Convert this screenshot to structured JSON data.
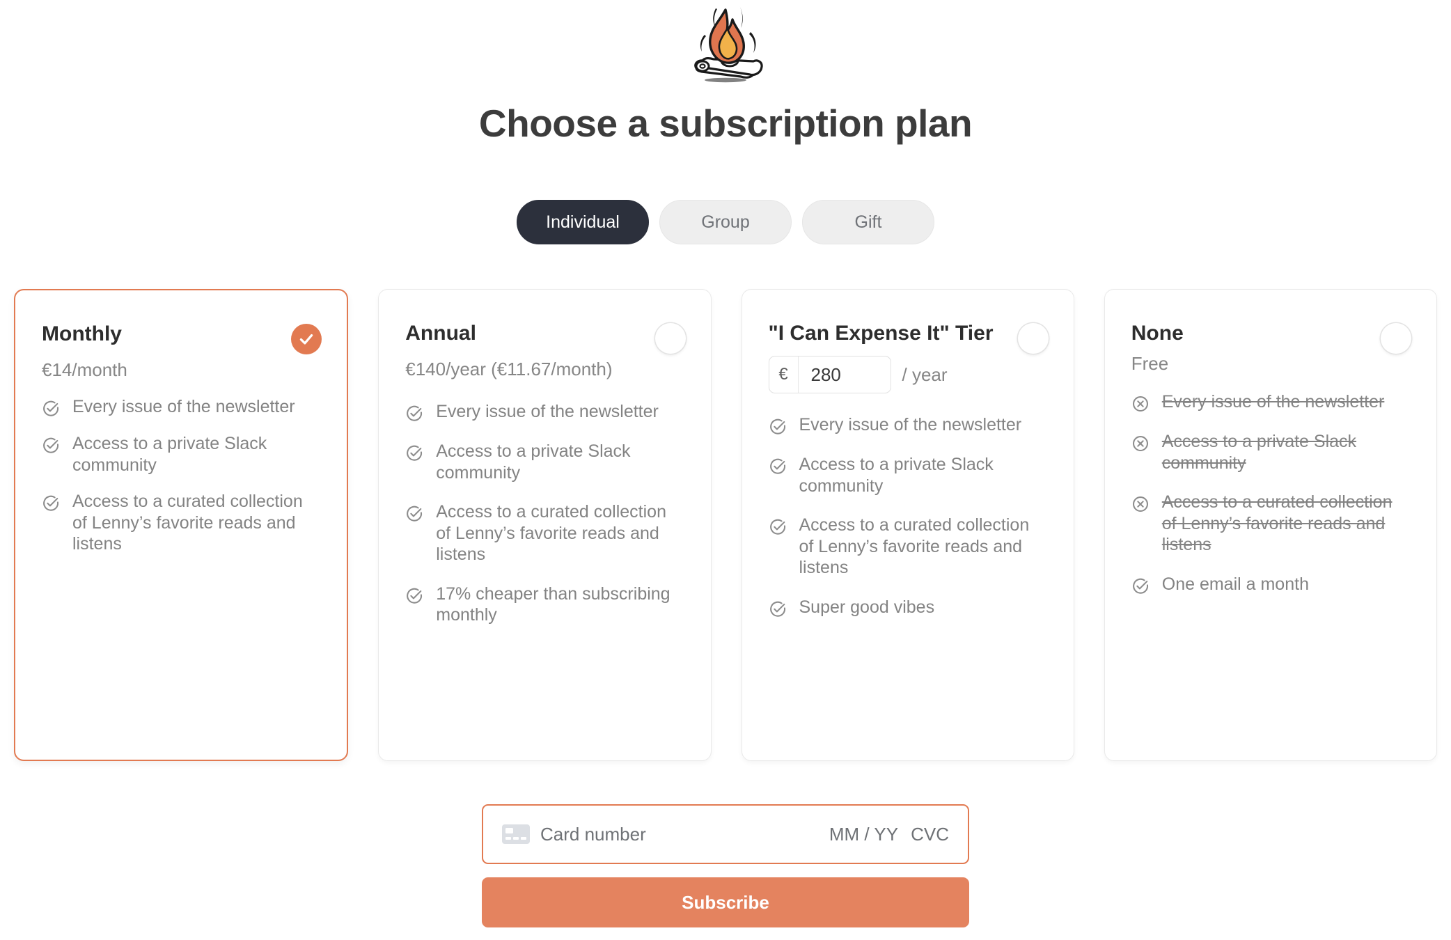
{
  "brand": {
    "logo_icon": "campfire-icon",
    "accent_color": "#e27a51",
    "button_color": "#e4835f",
    "dark_color": "#2c303c"
  },
  "header": {
    "title": "Choose a subscription plan"
  },
  "tabs": [
    {
      "label": "Individual",
      "active": true
    },
    {
      "label": "Group",
      "active": false
    },
    {
      "label": "Gift",
      "active": false
    }
  ],
  "plans": [
    {
      "name": "Monthly",
      "price": "€14/month",
      "selected": true,
      "selected_icon": "check-circle-filled-icon",
      "features": [
        {
          "text": "Every issue of the newsletter",
          "available": true,
          "icon": "check-circle-icon"
        },
        {
          "text": "Access to a private Slack community",
          "available": true,
          "icon": "check-circle-icon"
        },
        {
          "text": "Access to a curated collection of Lenny’s favorite reads and listens",
          "available": true,
          "icon": "check-circle-icon"
        }
      ]
    },
    {
      "name": "Annual",
      "price": "€140/year (€11.67/month)",
      "selected": false,
      "features": [
        {
          "text": "Every issue of the newsletter",
          "available": true,
          "icon": "check-circle-icon"
        },
        {
          "text": "Access to a private Slack community",
          "available": true,
          "icon": "check-circle-icon"
        },
        {
          "text": "Access to a curated collection of Lenny’s favorite reads and listens",
          "available": true,
          "icon": "check-circle-icon"
        },
        {
          "text": "17% cheaper than subscribing monthly",
          "available": true,
          "icon": "check-circle-icon"
        }
      ]
    },
    {
      "name": "\"I Can Expense It\" Tier",
      "selected": false,
      "custom_price": {
        "currency_symbol": "€",
        "amount": "280",
        "suffix": "/ year"
      },
      "features": [
        {
          "text": "Every issue of the newsletter",
          "available": true,
          "icon": "check-circle-icon"
        },
        {
          "text": "Access to a private Slack community",
          "available": true,
          "icon": "check-circle-icon"
        },
        {
          "text": "Access to a curated collection of Lenny’s favorite reads and listens",
          "available": true,
          "icon": "check-circle-icon"
        },
        {
          "text": "Super good vibes",
          "available": true,
          "icon": "check-circle-icon"
        }
      ]
    },
    {
      "name": "None",
      "price": "Free",
      "selected": false,
      "features": [
        {
          "text": "Every issue of the newsletter",
          "available": false,
          "icon": "x-circle-icon"
        },
        {
          "text": "Access to a private Slack community",
          "available": false,
          "icon": "x-circle-icon"
        },
        {
          "text": "Access to a curated collection of Lenny’s favorite reads and listens",
          "available": false,
          "icon": "x-circle-icon"
        },
        {
          "text": "One email a month",
          "available": true,
          "icon": "check-circle-icon"
        }
      ]
    }
  ],
  "payment": {
    "card_icon": "credit-card-icon",
    "card_number_placeholder": "Card number",
    "expiry_placeholder": "MM / YY",
    "cvc_placeholder": "CVC",
    "submit_label": "Subscribe"
  }
}
